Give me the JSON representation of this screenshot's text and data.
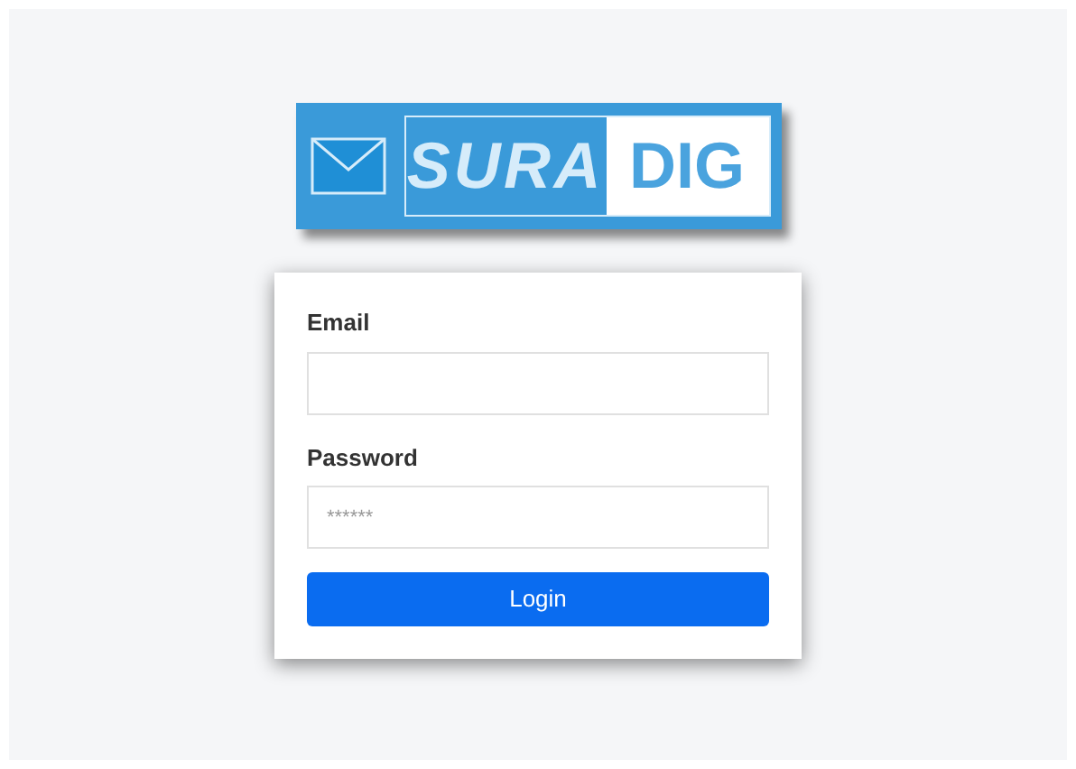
{
  "logo": {
    "part_1": "SURA",
    "part_2": "DIG"
  },
  "form": {
    "fields": [
      {
        "label": "Email"
      },
      {
        "label": "Password",
        "placeholder": "******"
      }
    ],
    "button": "Login"
  }
}
